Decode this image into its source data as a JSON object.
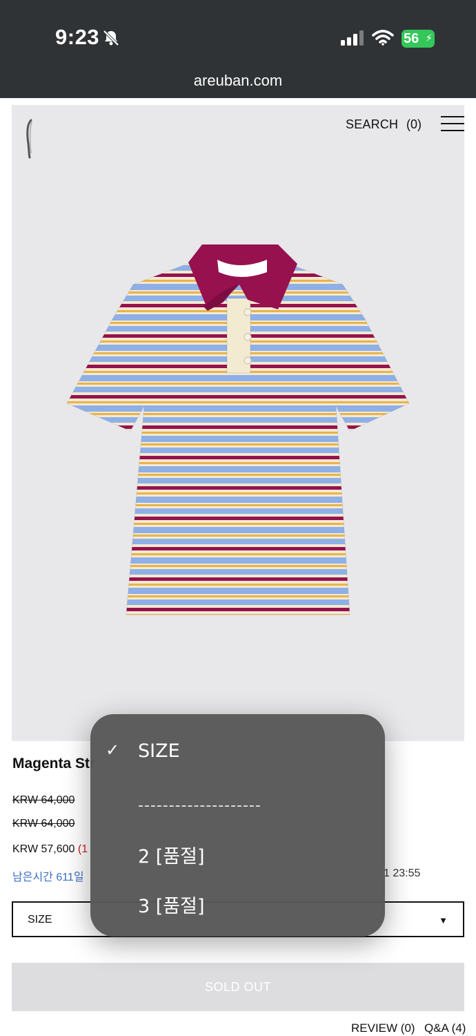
{
  "status_bar": {
    "time": "9:23",
    "battery": "56",
    "url": "areuban.com"
  },
  "header": {
    "search_label": "SEARCH",
    "cart_count": "(0)"
  },
  "product": {
    "name": "Magenta Str",
    "price_original_1": "KRW 64,000",
    "price_original_2": "KRW 64,000",
    "price_sale": "KRW 57,600",
    "price_discount_visible": "(1",
    "remaining_time": "남은시간 611일",
    "end_time": "1 23:55"
  },
  "size_select": {
    "label": "SIZE",
    "arrow": "▼"
  },
  "popup": {
    "options": [
      {
        "label": "SIZE",
        "checked": true
      },
      {
        "label": "--------------------",
        "checked": false
      },
      {
        "label": "2 [품절]",
        "checked": false
      },
      {
        "label": "3 [품절]",
        "checked": false
      }
    ],
    "check_mark": "✓"
  },
  "buttons": {
    "sold_out": "SOLD OUT"
  },
  "footer_tabs": {
    "review": "REVIEW (0)",
    "qna": "Q&A (4)"
  },
  "colors": {
    "status_bar_bg": "#303335",
    "image_bg": "#e8e7ea",
    "collar": "#96114e",
    "stripe_blue": "#8fb0e6",
    "stripe_cream": "#f3ead2",
    "discount": "#d01818",
    "time_link": "#3a6fc4"
  }
}
